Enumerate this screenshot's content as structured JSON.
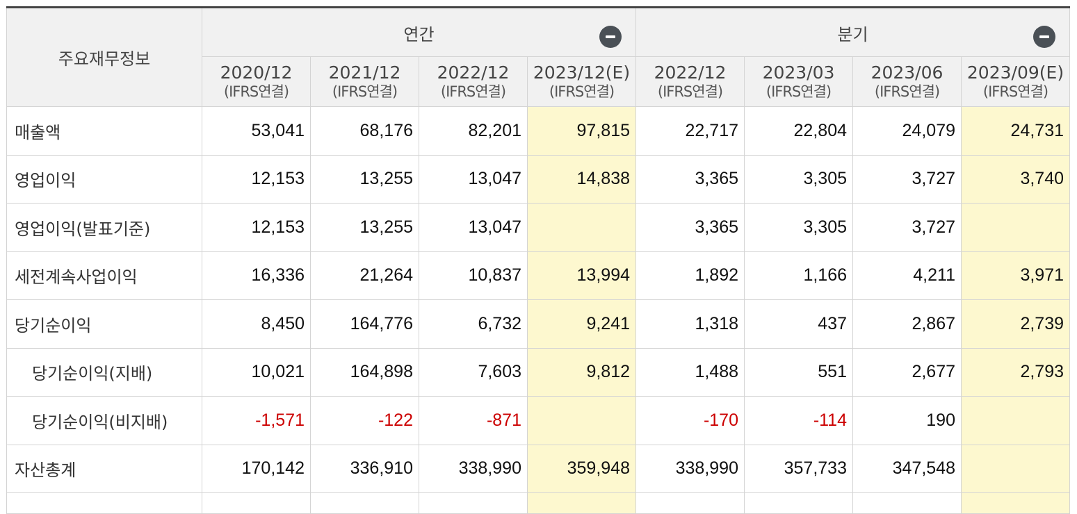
{
  "table": {
    "corner_label": "주요재무정보",
    "groups": {
      "annual": {
        "label": "연간",
        "toggle_icon": "minus-circle-icon"
      },
      "quarter": {
        "label": "분기",
        "toggle_icon": "minus-circle-icon"
      }
    },
    "columns": [
      {
        "period": "2020/12",
        "basis": "(IFRS연결)"
      },
      {
        "period": "2021/12",
        "basis": "(IFRS연결)"
      },
      {
        "period": "2022/12",
        "basis": "(IFRS연결)"
      },
      {
        "period": "2023/12(E)",
        "basis": "(IFRS연결)"
      },
      {
        "period": "2022/12",
        "basis": "(IFRS연결)"
      },
      {
        "period": "2023/03",
        "basis": "(IFRS연결)"
      },
      {
        "period": "2023/06",
        "basis": "(IFRS연결)"
      },
      {
        "period": "2023/09(E)",
        "basis": "(IFRS연결)"
      }
    ],
    "rows": [
      {
        "label": "매출액",
        "values": [
          "53,041",
          "68,176",
          "82,201",
          "97,815",
          "22,717",
          "22,804",
          "24,079",
          "24,731"
        ]
      },
      {
        "label": "영업이익",
        "values": [
          "12,153",
          "13,255",
          "13,047",
          "14,838",
          "3,365",
          "3,305",
          "3,727",
          "3,740"
        ]
      },
      {
        "label": "영업이익(발표기준)",
        "values": [
          "12,153",
          "13,255",
          "13,047",
          "",
          "3,365",
          "3,305",
          "3,727",
          ""
        ]
      },
      {
        "label": "세전계속사업이익",
        "values": [
          "16,336",
          "21,264",
          "10,837",
          "13,994",
          "1,892",
          "1,166",
          "4,211",
          "3,971"
        ]
      },
      {
        "label": "당기순이익",
        "values": [
          "8,450",
          "164,776",
          "6,732",
          "9,241",
          "1,318",
          "437",
          "2,867",
          "2,739"
        ]
      },
      {
        "label": "당기순이익(지배)",
        "values": [
          "10,021",
          "164,898",
          "7,603",
          "9,812",
          "1,488",
          "551",
          "2,677",
          "2,793"
        ]
      },
      {
        "label": "당기순이익(비지배)",
        "values": [
          "-1,571",
          "-122",
          "-871",
          "",
          "-170",
          "-114",
          "190",
          ""
        ]
      },
      {
        "label": "자산총계",
        "values": [
          "170,142",
          "336,910",
          "338,990",
          "359,948",
          "338,990",
          "357,733",
          "347,548",
          ""
        ]
      }
    ],
    "colors": {
      "estimate_bg": "#fdf8cf",
      "negative": "#cc0000",
      "header_bg": "#f1f1f1"
    }
  }
}
